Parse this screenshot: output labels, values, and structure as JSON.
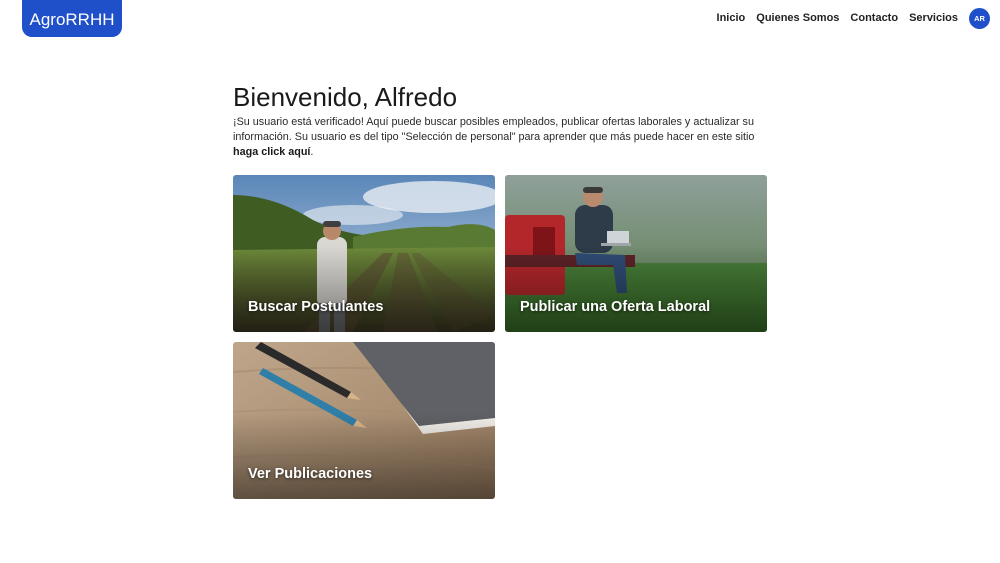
{
  "header": {
    "logo": "AgroRRHH",
    "nav": [
      "Inicio",
      "Quienes Somos",
      "Contacto",
      "Servicios"
    ],
    "avatar_initials": "AR",
    "accent_color": "#1f4fc9"
  },
  "main": {
    "greeting": "Bienvenido, Alfredo",
    "intro_text": "¡Su usuario está verificado! Aquí puede buscar posibles empleados, publicar ofertas laborales y actualizar su información. Su usuario es del tipo \"Selección de personal\" para aprender que más puede hacer en este sitio ",
    "intro_link": "haga click aquí",
    "intro_end": "."
  },
  "cards": [
    {
      "title": "Buscar Postulantes",
      "image": "farmer-in-cornfield"
    },
    {
      "title": "Publicar una Oferta Laboral",
      "image": "man-with-laptop-on-truck"
    },
    {
      "title": "Ver Publicaciones",
      "image": "pencils-and-notebook"
    }
  ]
}
